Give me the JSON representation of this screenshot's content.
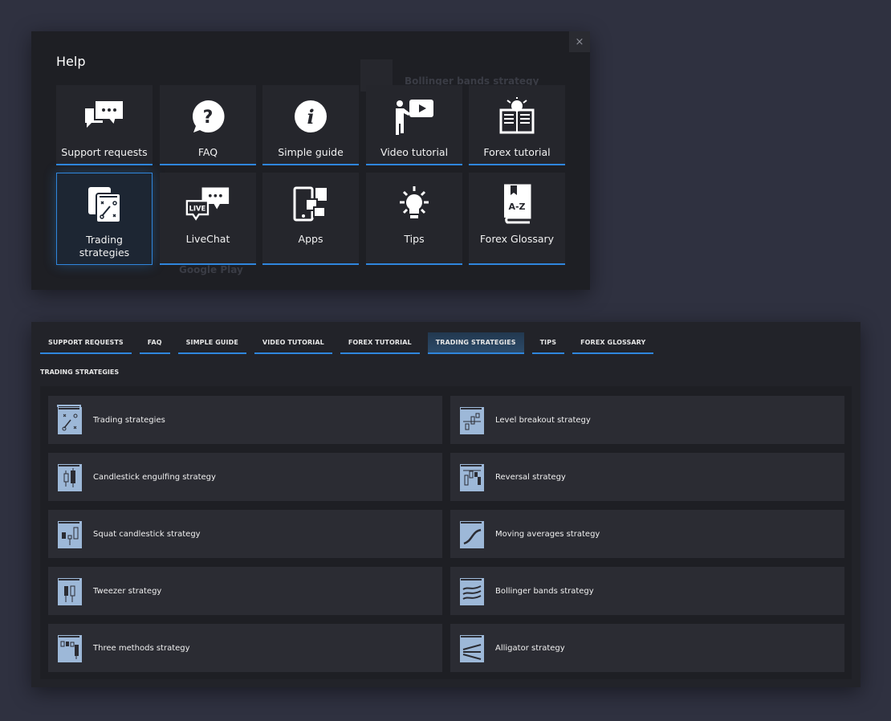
{
  "help_modal": {
    "title": "Help",
    "close_icon": "×",
    "tiles": [
      {
        "label": "Support requests",
        "icon": "chat-bubbles-icon"
      },
      {
        "label": "FAQ",
        "icon": "question-bubble-icon"
      },
      {
        "label": "Simple guide",
        "icon": "info-circle-icon"
      },
      {
        "label": "Video tutorial",
        "icon": "presenter-video-icon"
      },
      {
        "label": "Forex tutorial",
        "icon": "book-lightbulb-icon"
      },
      {
        "label": "Trading strategies",
        "icon": "strategy-books-icon",
        "active": true
      },
      {
        "label": "LiveChat",
        "icon": "live-chat-icon",
        "badge": "LIVE"
      },
      {
        "label": "Apps",
        "icon": "devices-apps-icon"
      },
      {
        "label": "Tips",
        "icon": "lightbulb-icon"
      },
      {
        "label": "Forex Glossary",
        "icon": "glossary-book-icon",
        "badge": "A-Z"
      }
    ],
    "ghost_texts": [
      "Bollinger bands strategy",
      "Google Play"
    ]
  },
  "strategies_panel": {
    "tabs": [
      {
        "label": "SUPPORT REQUESTS"
      },
      {
        "label": "FAQ"
      },
      {
        "label": "SIMPLE GUIDE"
      },
      {
        "label": "VIDEO TUTORIAL"
      },
      {
        "label": "FOREX TUTORIAL"
      },
      {
        "label": "TRADING STRATEGIES",
        "active": true
      },
      {
        "label": "TIPS"
      },
      {
        "label": "FOREX GLOSSARY"
      }
    ],
    "section_title": "TRADING STRATEGIES",
    "items": [
      {
        "label": "Trading strategies",
        "icon": "strategy-map-icon"
      },
      {
        "label": "Level breakout strategy",
        "icon": "level-breakout-icon"
      },
      {
        "label": "Candlestick engulfing strategy",
        "icon": "candlestick-engulfing-icon"
      },
      {
        "label": "Reversal strategy",
        "icon": "reversal-icon"
      },
      {
        "label": "Squat candlestick strategy",
        "icon": "squat-candlestick-icon"
      },
      {
        "label": "Moving averages strategy",
        "icon": "moving-average-icon"
      },
      {
        "label": "Tweezer strategy",
        "icon": "tweezer-icon"
      },
      {
        "label": "Bollinger bands strategy",
        "icon": "bollinger-bands-icon"
      },
      {
        "label": "Three methods strategy",
        "icon": "three-methods-icon"
      },
      {
        "label": "Alligator strategy",
        "icon": "alligator-icon"
      }
    ]
  },
  "colors": {
    "accent": "#2f86dd",
    "pointer": "#2fd14a",
    "icon_book": "#9db8d8"
  }
}
